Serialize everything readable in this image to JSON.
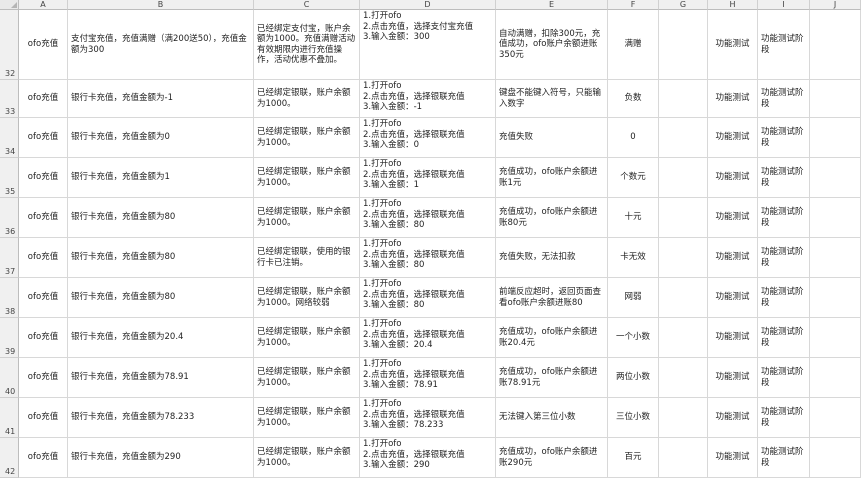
{
  "columns": [
    "A",
    "B",
    "C",
    "D",
    "E",
    "F",
    "G",
    "H",
    "I",
    "J"
  ],
  "rows": [
    {
      "num": "32",
      "module": "ofo充值",
      "title": "支付宝充值，充值满赠（满200送50），充值金额为300",
      "precondition": "已经绑定支付宝，账户余额为1000。充值满赠活动有效期限内进行充值操作，活动优惠不叠加。",
      "steps": "1.打开ofo\n2.点击充值，选择支付宝充值\n3.输入金额：300",
      "expected": "自动满赠，扣除300元，充值成功，ofo账户余额进账350元",
      "type": "满赠",
      "g": "",
      "h": "功能测试",
      "i": "功能测试阶段",
      "j": ""
    },
    {
      "num": "33",
      "module": "ofo充值",
      "title": "银行卡充值，充值金额为-1",
      "precondition": "已经绑定银联，账户余额为1000。",
      "steps": "1.打开ofo\n2.点击充值，选择银联充值\n3.输入金额：-1",
      "expected": "键盘不能键入符号，只能输入数字",
      "type": "负数",
      "g": "",
      "h": "功能测试",
      "i": "功能测试阶段",
      "j": ""
    },
    {
      "num": "34",
      "module": "ofo充值",
      "title": "银行卡充值，充值金额为0",
      "precondition": "已经绑定银联，账户余额为1000。",
      "steps": "1.打开ofo\n2.点击充值，选择银联充值\n3.输入金额：0",
      "expected": "充值失败",
      "type": "0",
      "g": "",
      "h": "功能测试",
      "i": "功能测试阶段",
      "j": ""
    },
    {
      "num": "35",
      "module": "ofo充值",
      "title": "银行卡充值，充值金额为1",
      "precondition": "已经绑定银联，账户余额为1000。",
      "steps": "1.打开ofo\n2.点击充值，选择银联充值\n3.输入金额：1",
      "expected": "充值成功，ofo账户余额进账1元",
      "type": "个数元",
      "g": "",
      "h": "功能测试",
      "i": "功能测试阶段",
      "j": ""
    },
    {
      "num": "36",
      "module": "ofo充值",
      "title": "银行卡充值，充值金额为80",
      "precondition": "已经绑定银联，账户余额为1000。",
      "steps": "1.打开ofo\n2.点击充值，选择银联充值\n3.输入金额：80",
      "expected": "充值成功，ofo账户余额进账80元",
      "type": "十元",
      "g": "",
      "h": "功能测试",
      "i": "功能测试阶段",
      "j": ""
    },
    {
      "num": "37",
      "module": "ofo充值",
      "title": "银行卡充值，充值金额为80",
      "precondition": "已经绑定银联，使用的银行卡已注销。",
      "steps": "1.打开ofo\n2.点击充值，选择银联充值\n3.输入金额：80",
      "expected": "充值失败，无法扣款",
      "type": "卡无效",
      "g": "",
      "h": "功能测试",
      "i": "功能测试阶段",
      "j": ""
    },
    {
      "num": "38",
      "module": "ofo充值",
      "title": "银行卡充值，充值金额为80",
      "precondition": "已经绑定银联，账户余额为1000。网络较弱",
      "steps": "1.打开ofo\n2.点击充值，选择银联充值\n3.输入金额：80",
      "expected": "前端反应超时，返回页面查看ofo账户余额进账80",
      "type": "网弱",
      "g": "",
      "h": "功能测试",
      "i": "功能测试阶段",
      "j": ""
    },
    {
      "num": "39",
      "module": "ofo充值",
      "title": "银行卡充值，充值金额为20.4",
      "precondition": "已经绑定银联，账户余额为1000。",
      "steps": "1.打开ofo\n2.点击充值，选择银联充值\n3.输入金额：20.4",
      "expected": "充值成功，ofo账户余额进账20.4元",
      "type": "一个小数",
      "g": "",
      "h": "功能测试",
      "i": "功能测试阶段",
      "j": ""
    },
    {
      "num": "40",
      "module": "ofo充值",
      "title": "银行卡充值，充值金额为78.91",
      "precondition": "已经绑定银联，账户余额为1000。",
      "steps": "1.打开ofo\n2.点击充值，选择银联充值\n3.输入金额：78.91",
      "expected": "充值成功，ofo账户余额进账78.91元",
      "type": "两位小数",
      "g": "",
      "h": "功能测试",
      "i": "功能测试阶段",
      "j": ""
    },
    {
      "num": "41",
      "module": "ofo充值",
      "title": "银行卡充值，充值金额为78.233",
      "precondition": "已经绑定银联，账户余额为1000。",
      "steps": "1.打开ofo\n2.点击充值，选择银联充值\n3.输入金额：78.233",
      "expected": "无法键入第三位小数",
      "type": "三位小数",
      "g": "",
      "h": "功能测试",
      "i": "功能测试阶段",
      "j": ""
    },
    {
      "num": "42",
      "module": "ofo充值",
      "title": "银行卡充值，充值金额为290",
      "precondition": "已经绑定银联，账户余额为1000。",
      "steps": "1.打开ofo\n2.点击充值，选择银联充值\n3.输入金额：290",
      "expected": "充值成功，ofo账户余额进账290元",
      "type": "百元",
      "g": "",
      "h": "功能测试",
      "i": "功能测试阶段",
      "j": ""
    }
  ]
}
